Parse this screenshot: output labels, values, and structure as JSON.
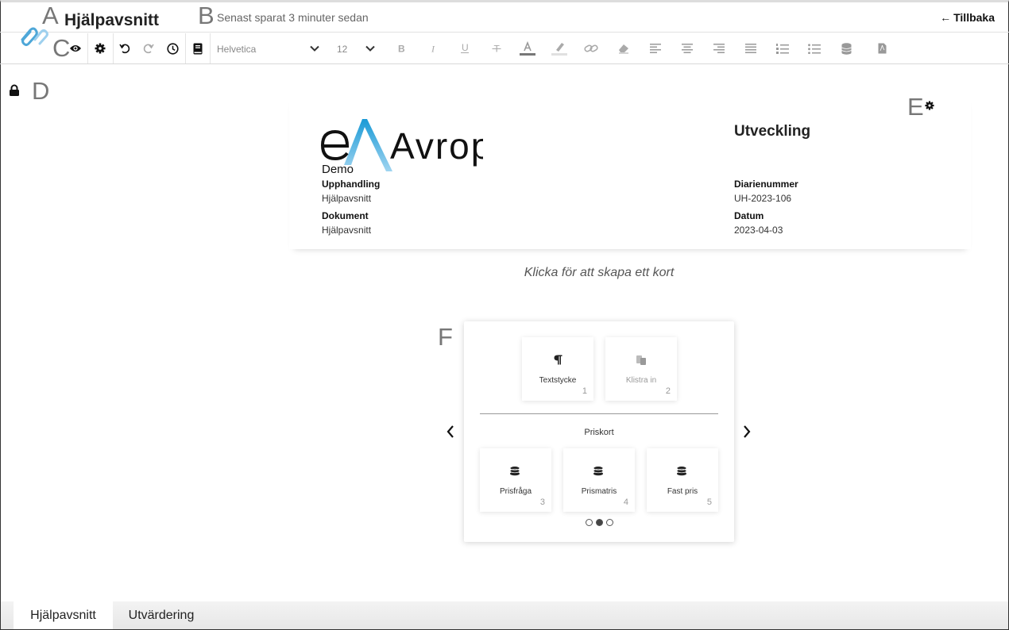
{
  "header": {
    "app_title": "Hjälpavsnitt",
    "saved_status": "Senast sparat 3 minuter sedan",
    "back_label": "Tillbaka",
    "logo_icon": "paperclip-logo-icon"
  },
  "annotations": {
    "a": "A",
    "b": "B",
    "c": "C",
    "d": "D",
    "e": "E",
    "f": "F"
  },
  "toolbar": {
    "view_toggles": [
      "eye-icon",
      "gear-icon"
    ],
    "history": [
      "undo-icon",
      "redo-icon",
      "clock-icon"
    ],
    "book_icon": "book-icon",
    "font_family": "Helvetica",
    "font_size": "12",
    "format_icons": [
      "bold-icon",
      "italic-icon",
      "underline-icon",
      "strikethrough-icon",
      "text-color-icon",
      "highlight-icon",
      "link-icon",
      "eraser-icon",
      "align-left-icon",
      "align-center-icon",
      "align-right-icon",
      "align-justify-icon",
      "ordered-list-icon",
      "unordered-list-icon",
      "database-icon",
      "pdf-file-icon"
    ],
    "text_color": "#777777",
    "highlight_color": "#e0e0e0"
  },
  "document": {
    "brand_name": "Avrop",
    "brand_sub": "Demo",
    "kind": "Utveckling",
    "fields": [
      {
        "label": "Upphandling",
        "value": "Hjälpavsnitt"
      },
      {
        "label": "Dokument",
        "value": "Hjälpavsnitt"
      },
      {
        "label": "Diarienummer",
        "value": "UH-2023-106"
      },
      {
        "label": "Datum",
        "value": "2023-04-03"
      }
    ],
    "brand_colors": {
      "primary": "#1a9ad6",
      "light": "#7fc8ee",
      "text": "#111111"
    }
  },
  "hint": "Klicka för att skapa ett kort",
  "picker": {
    "top_cards": [
      {
        "label": "Textstycke",
        "number": "1",
        "icon": "pilcrow-icon",
        "enabled": true
      },
      {
        "label": "Klistra in",
        "number": "2",
        "icon": "paste-icon",
        "enabled": false
      }
    ],
    "group_label": "Priskort",
    "price_cards": [
      {
        "label": "Prisfråga",
        "number": "3",
        "icon": "coins-icon"
      },
      {
        "label": "Prismatris",
        "number": "4",
        "icon": "coins-icon"
      },
      {
        "label": "Fast pris",
        "number": "5",
        "icon": "coins-icon"
      }
    ],
    "pages": 3,
    "active_page": 2
  },
  "tabs": [
    {
      "label": "Hjälpavsnitt",
      "active": true
    },
    {
      "label": "Utvärdering",
      "active": false
    }
  ]
}
